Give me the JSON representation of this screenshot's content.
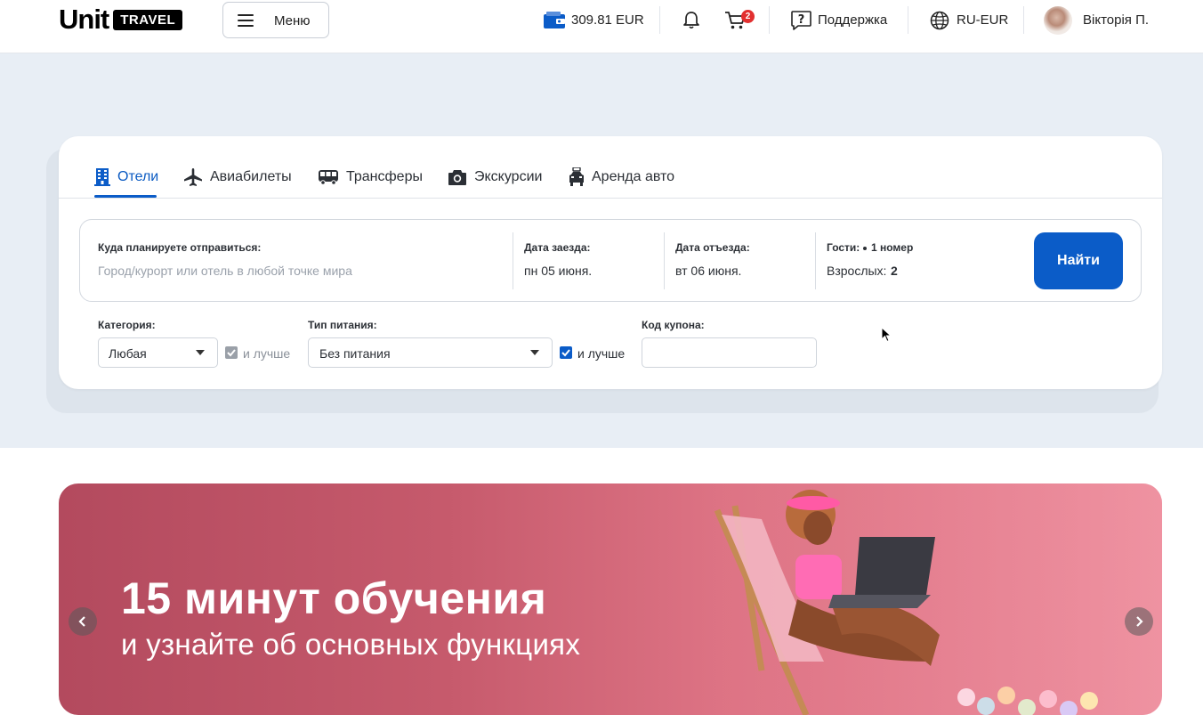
{
  "header": {
    "logo": {
      "unit": "Unit",
      "travel": "TRAVEL"
    },
    "menu_label": "Меню",
    "wallet": "309.81 EUR",
    "cart_count": "2",
    "support": "Поддержка",
    "locale": "RU-EUR",
    "user_name": "Вікторія П."
  },
  "tabs": [
    {
      "label": "Отели",
      "icon": "hotel-icon",
      "active": true
    },
    {
      "label": "Авиабилеты",
      "icon": "plane-icon"
    },
    {
      "label": "Трансферы",
      "icon": "bus-icon"
    },
    {
      "label": "Экскурсии",
      "icon": "camera-icon"
    },
    {
      "label": "Аренда авто",
      "icon": "car-icon"
    }
  ],
  "search": {
    "destination_label": "Куда планируете отправиться:",
    "destination_placeholder": "Город/курорт или отель в любой точке мира",
    "checkin_label": "Дата заезда:",
    "checkin_value": "пн 05 июня.",
    "checkout_label": "Дата отъезда:",
    "checkout_value": "вт 06 июня.",
    "guests_label": "Гости:",
    "rooms_text": "1 номер",
    "adults_label": "Взрослых:",
    "adults_value": "2",
    "find_label": "Найти"
  },
  "filters": {
    "category_label": "Категория:",
    "category_value": "Любая",
    "category_better": "и лучше",
    "meal_label": "Тип питания:",
    "meal_value": "Без питания",
    "meal_better": "и лучше",
    "coupon_label": "Код купона:",
    "coupon_value": ""
  },
  "banner": {
    "title": "15 минут обучения",
    "subtitle": "и узнайте об основных функциях"
  },
  "colors": {
    "accent": "#0b5cc8",
    "badge": "#e23030",
    "section_bg": "#e8eef5",
    "banner": "#c65a6c"
  }
}
